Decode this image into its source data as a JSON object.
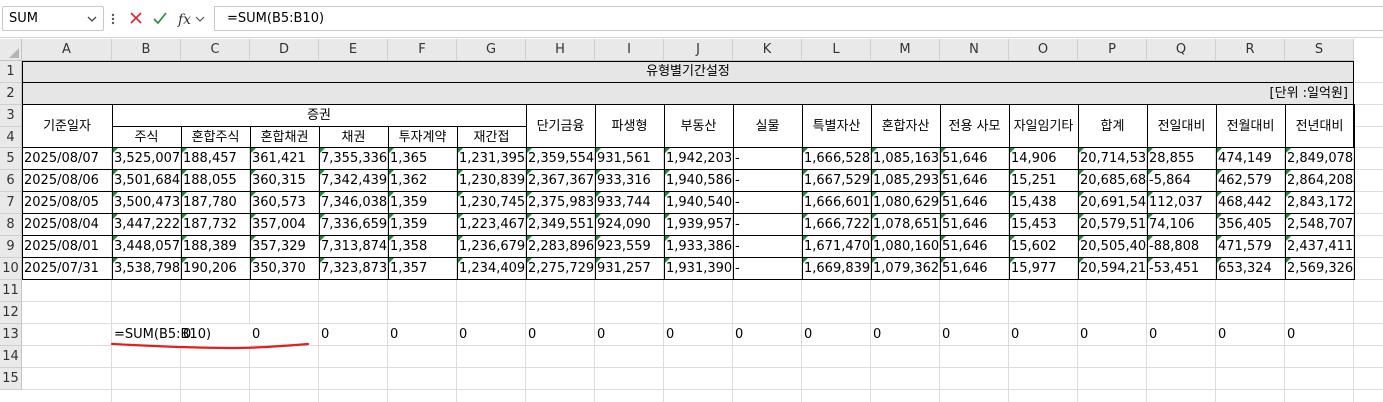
{
  "formula_bar": {
    "name_box": "SUM",
    "formula": "=SUM(B5:B10)",
    "cancel_icon": "close-icon",
    "enter_icon": "check-icon",
    "fx_label": "fx"
  },
  "columns": [
    "A",
    "B",
    "C",
    "D",
    "E",
    "F",
    "G",
    "H",
    "I",
    "J",
    "K",
    "L",
    "M",
    "N",
    "O",
    "P",
    "Q",
    "R",
    "S"
  ],
  "rows": [
    "1",
    "2",
    "3",
    "4",
    "5",
    "6",
    "7",
    "8",
    "9",
    "10",
    "11",
    "12",
    "13",
    "14",
    "15"
  ],
  "sheet": {
    "title": "유형별기간설정",
    "unit": "[단위 :일억원]",
    "header_date": "기준일자",
    "group_securities": "증권",
    "sub_headers": [
      "주식",
      "혼합주식",
      "혼합채권",
      "채권",
      "투자계약",
      "재간접"
    ],
    "other_headers": [
      "단기금융",
      "파생형",
      "부동산",
      "실물",
      "특별자산",
      "혼합자산",
      "전용 사모",
      "자일임기타",
      "합계",
      "전일대비",
      "전월대비",
      "전년대비"
    ],
    "data_rows": [
      [
        "2025/08/07",
        "3,525,007",
        "188,457",
        "361,421",
        "7,355,336",
        "1,365",
        "1,231,395",
        "2,359,554",
        "931,561",
        "1,942,203",
        "-",
        "1,666,528",
        "1,085,163",
        "51,646",
        "14,906",
        "20,714,539",
        "28,855",
        "474,149",
        "2,849,078"
      ],
      [
        "2025/08/06",
        "3,501,684",
        "188,055",
        "360,315",
        "7,342,439",
        "1,362",
        "1,230,839",
        "2,367,367",
        "933,316",
        "1,940,586",
        "-",
        "1,667,529",
        "1,085,293",
        "51,646",
        "15,251",
        "20,685,684",
        "-5,864",
        "462,579",
        "2,864,208"
      ],
      [
        "2025/08/05",
        "3,500,473",
        "187,780",
        "360,573",
        "7,346,038",
        "1,359",
        "1,230,745",
        "2,375,983",
        "933,744",
        "1,940,540",
        "-",
        "1,666,601",
        "1,080,629",
        "51,646",
        "15,438",
        "20,691,548",
        "112,037",
        "468,442",
        "2,843,172"
      ],
      [
        "2025/08/04",
        "3,447,222",
        "187,732",
        "357,004",
        "7,336,659",
        "1,359",
        "1,223,467",
        "2,349,551",
        "924,090",
        "1,939,957",
        "-",
        "1,666,722",
        "1,078,651",
        "51,646",
        "15,453",
        "20,579,511",
        "74,106",
        "356,405",
        "2,548,707"
      ],
      [
        "2025/08/01",
        "3,448,057",
        "188,389",
        "357,329",
        "7,313,874",
        "1,358",
        "1,236,679",
        "2,283,896",
        "923,559",
        "1,933,386",
        "-",
        "1,671,470",
        "1,080,160",
        "51,646",
        "15,602",
        "20,505,405",
        "-88,808",
        "471,579",
        "2,437,411"
      ],
      [
        "2025/07/31",
        "3,538,798",
        "190,206",
        "350,370",
        "7,323,873",
        "1,357",
        "1,234,409",
        "2,275,729",
        "931,257",
        "1,931,390",
        "-",
        "1,669,839",
        "1,079,362",
        "51,646",
        "15,977",
        "20,594,213",
        "-53,451",
        "653,324",
        "2,569,326"
      ]
    ],
    "row13": {
      "B": "=SUM(B5:B10)",
      "zeros": [
        "0",
        "0",
        "0",
        "0",
        "0",
        "0",
        "0",
        "0",
        "0",
        "0",
        "0",
        "0",
        "0",
        "0",
        "0",
        "0",
        "0"
      ]
    }
  },
  "colors": {
    "header_bg": "#e6e6e6",
    "indicator_green": "#1e8a3a",
    "annotation_red": "#e02020",
    "grid_line": "#dcdcdc"
  }
}
